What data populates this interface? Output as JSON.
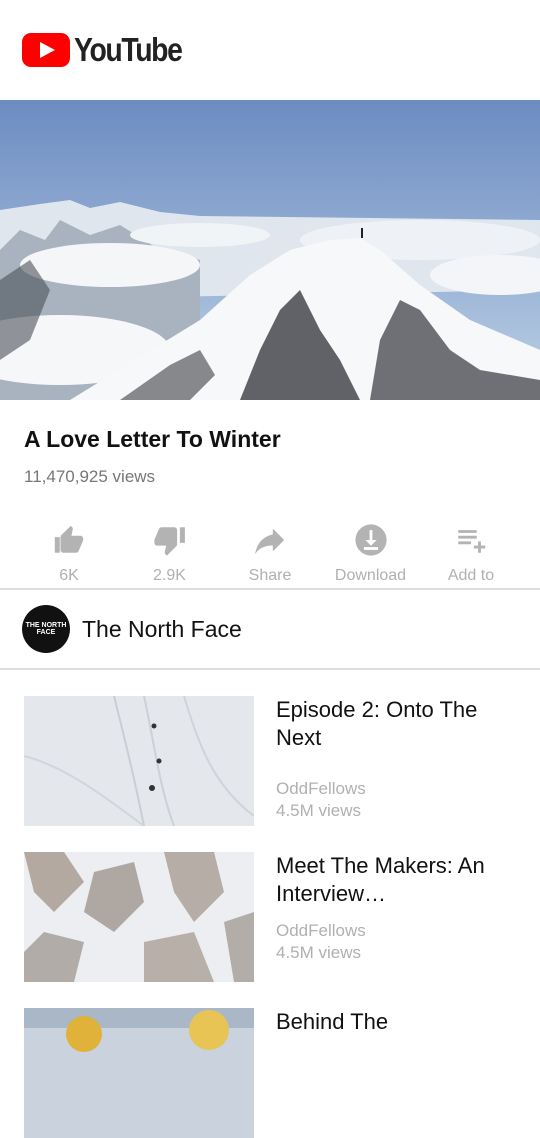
{
  "header": {
    "logo_text": "YouTube"
  },
  "video": {
    "title": "A Love Letter To Winter",
    "views": "11,470,925 views"
  },
  "actions": [
    {
      "icon": "thumbs-up-icon",
      "label": "6K"
    },
    {
      "icon": "thumbs-down-icon",
      "label": "2.9K"
    },
    {
      "icon": "share-icon",
      "label": "Share"
    },
    {
      "icon": "download-icon",
      "label": "Download"
    },
    {
      "icon": "add-to-playlist-icon",
      "label": "Add to"
    }
  ],
  "channel": {
    "name": "The North Face",
    "avatar_text": "THE NORTH FACE"
  },
  "related": [
    {
      "title": "Episode 2: Onto The Next",
      "channel": "OddFellows",
      "views": "4.5M views"
    },
    {
      "title": "Meet The Makers: An Interview…",
      "channel": "OddFellows",
      "views": "4.5M views"
    },
    {
      "title": "Behind The",
      "channel": "",
      "views": ""
    }
  ],
  "colors": {
    "brand_red": "#ff0000",
    "muted": "#aaaaaa"
  }
}
